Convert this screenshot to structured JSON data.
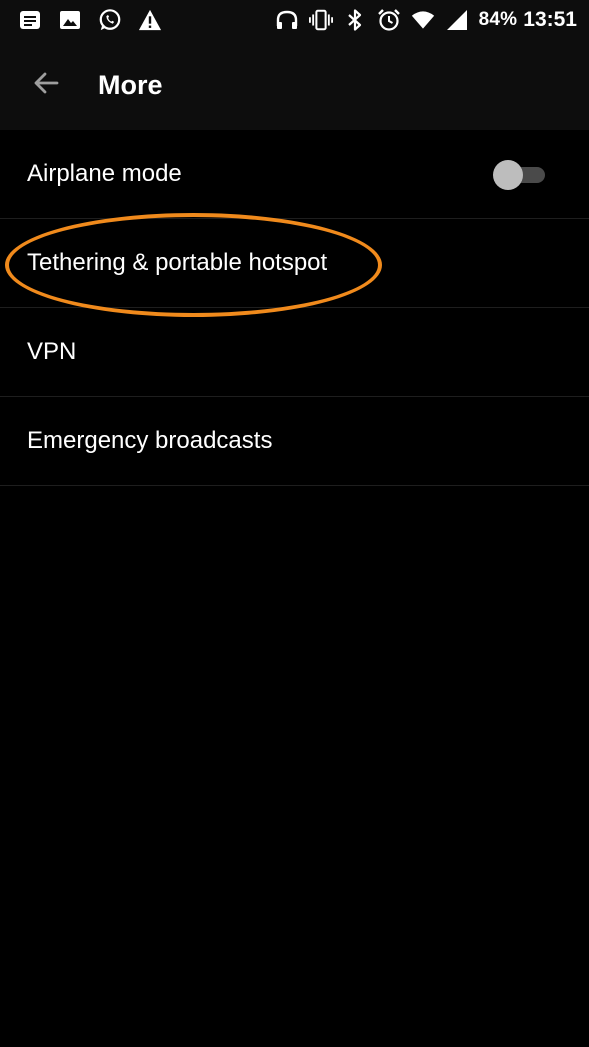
{
  "status_bar": {
    "left_icons": [
      "notes-icon",
      "image-icon",
      "whatsapp-icon",
      "warning-icon"
    ],
    "right_icons": [
      "headphones-icon",
      "vibrate-icon",
      "bluetooth-icon",
      "alarm-icon",
      "wifi-icon",
      "signal-icon"
    ],
    "battery": "84%",
    "time": "13:51"
  },
  "app_bar": {
    "title": "More"
  },
  "settings": {
    "items": [
      {
        "label": "Airplane mode",
        "toggle": false
      },
      {
        "label": "Tethering & portable hotspot"
      },
      {
        "label": "VPN"
      },
      {
        "label": "Emergency broadcasts"
      }
    ]
  },
  "colors": {
    "background": "#000000",
    "app_bar": "#0d0d0d",
    "annotation": "#f08a1c",
    "toggle_thumb": "#bdbdbd",
    "toggle_track": "#4a4a4a"
  }
}
